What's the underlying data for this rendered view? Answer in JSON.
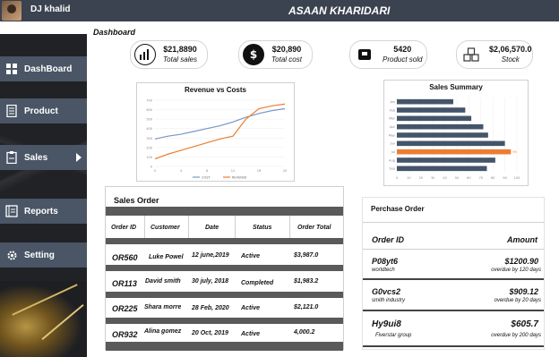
{
  "header": {
    "user_name": "DJ khalid",
    "app_title": "ASAAN KHARIDARI"
  },
  "colors": {
    "header_bg": "#3b4250",
    "nav_bg": "#4a5566",
    "line_blue": "#7a95c8",
    "line_orange": "#ed7d31",
    "bar_blue": "#44546a",
    "bar_orange": "#ed7d31"
  },
  "sidebar": {
    "items": [
      {
        "label": "DashBoard",
        "icon": "grid-icon"
      },
      {
        "label": "Product",
        "icon": "document-icon"
      },
      {
        "label": "Sales",
        "icon": "clipboard-icon"
      },
      {
        "label": "Reports",
        "icon": "ledger-icon"
      },
      {
        "label": "Setting",
        "icon": "gear-icon"
      }
    ]
  },
  "main": {
    "title": "Dashboard"
  },
  "kpis": [
    {
      "value": "$21,8890",
      "label": "Total sales",
      "icon": "bar-chart-icon"
    },
    {
      "value": "$20,890",
      "label": "Total cost",
      "icon": "dollar-icon"
    },
    {
      "value": "5420",
      "label": "Product sold",
      "icon": "box-icon"
    },
    {
      "value": "$2,06,570.0",
      "label": "Stock",
      "icon": "boxes-icon"
    }
  ],
  "chart_data": [
    {
      "type": "line",
      "title": "Revenue vs Costs",
      "x": [
        0,
        2,
        4,
        6,
        8,
        10,
        12,
        14,
        16,
        18,
        20
      ],
      "ylim": [
        0,
        700
      ],
      "series": [
        {
          "name": "COST",
          "values": [
            290,
            320,
            340,
            370,
            400,
            430,
            470,
            520,
            560,
            590,
            610
          ]
        },
        {
          "name": "REVENUE",
          "values": [
            80,
            130,
            170,
            210,
            250,
            290,
            320,
            500,
            610,
            640,
            660
          ]
        }
      ],
      "legend": "bottom"
    },
    {
      "type": "bar",
      "title": "Sales Summary",
      "orientation": "horizontal",
      "categories": [
        "Jan",
        "Feb",
        "Mar",
        "Apr",
        "May",
        "Jun",
        "Jul",
        "Aug",
        "Sep"
      ],
      "values": [
        47,
        57,
        62,
        72,
        76,
        90,
        95,
        82,
        75
      ],
      "xlim": [
        0,
        100
      ],
      "xticks": [
        0,
        10,
        20,
        30,
        40,
        50,
        60,
        70,
        80,
        90,
        100
      ],
      "highlight_index": 6,
      "highlight_label": "95"
    }
  ],
  "sales_order": {
    "title": "Sales Order",
    "columns": [
      "Order ID",
      "Customer",
      "Date",
      "Status",
      "Order Total"
    ],
    "rows": [
      {
        "id": "OR560",
        "customer": "Luke Powel",
        "date": "12 june,2019",
        "status": "Active",
        "total": "$3,987.0"
      },
      {
        "id": "OR113",
        "customer": "David smith",
        "date": "30 july, 2018",
        "status": "Completed",
        "total": "$1,983.2"
      },
      {
        "id": "OR225",
        "customer": "Shara morre",
        "date": "28 Feb, 2020",
        "status": "Active",
        "total": "$2,121.0"
      },
      {
        "id": "OR932",
        "customer": "Alina gomez",
        "date": "20 Oct, 2019",
        "status": "Active",
        "total": "4,000.2"
      }
    ]
  },
  "purchase_order": {
    "title": "Perchase Order",
    "columns": [
      "Order ID",
      "Amount"
    ],
    "rows": [
      {
        "id": "P08yt6",
        "vendor": "worldtech",
        "amount": "$1200.90",
        "due": "overdue by 120 days"
      },
      {
        "id": "G0vcs2",
        "vendor": "smith industry",
        "amount": "$909.12",
        "due": "overdue by 20 days"
      },
      {
        "id": "Hy9ui8",
        "vendor": "Fiverstar group",
        "amount": "$605.7",
        "due": "overdue by 200 days"
      }
    ]
  }
}
